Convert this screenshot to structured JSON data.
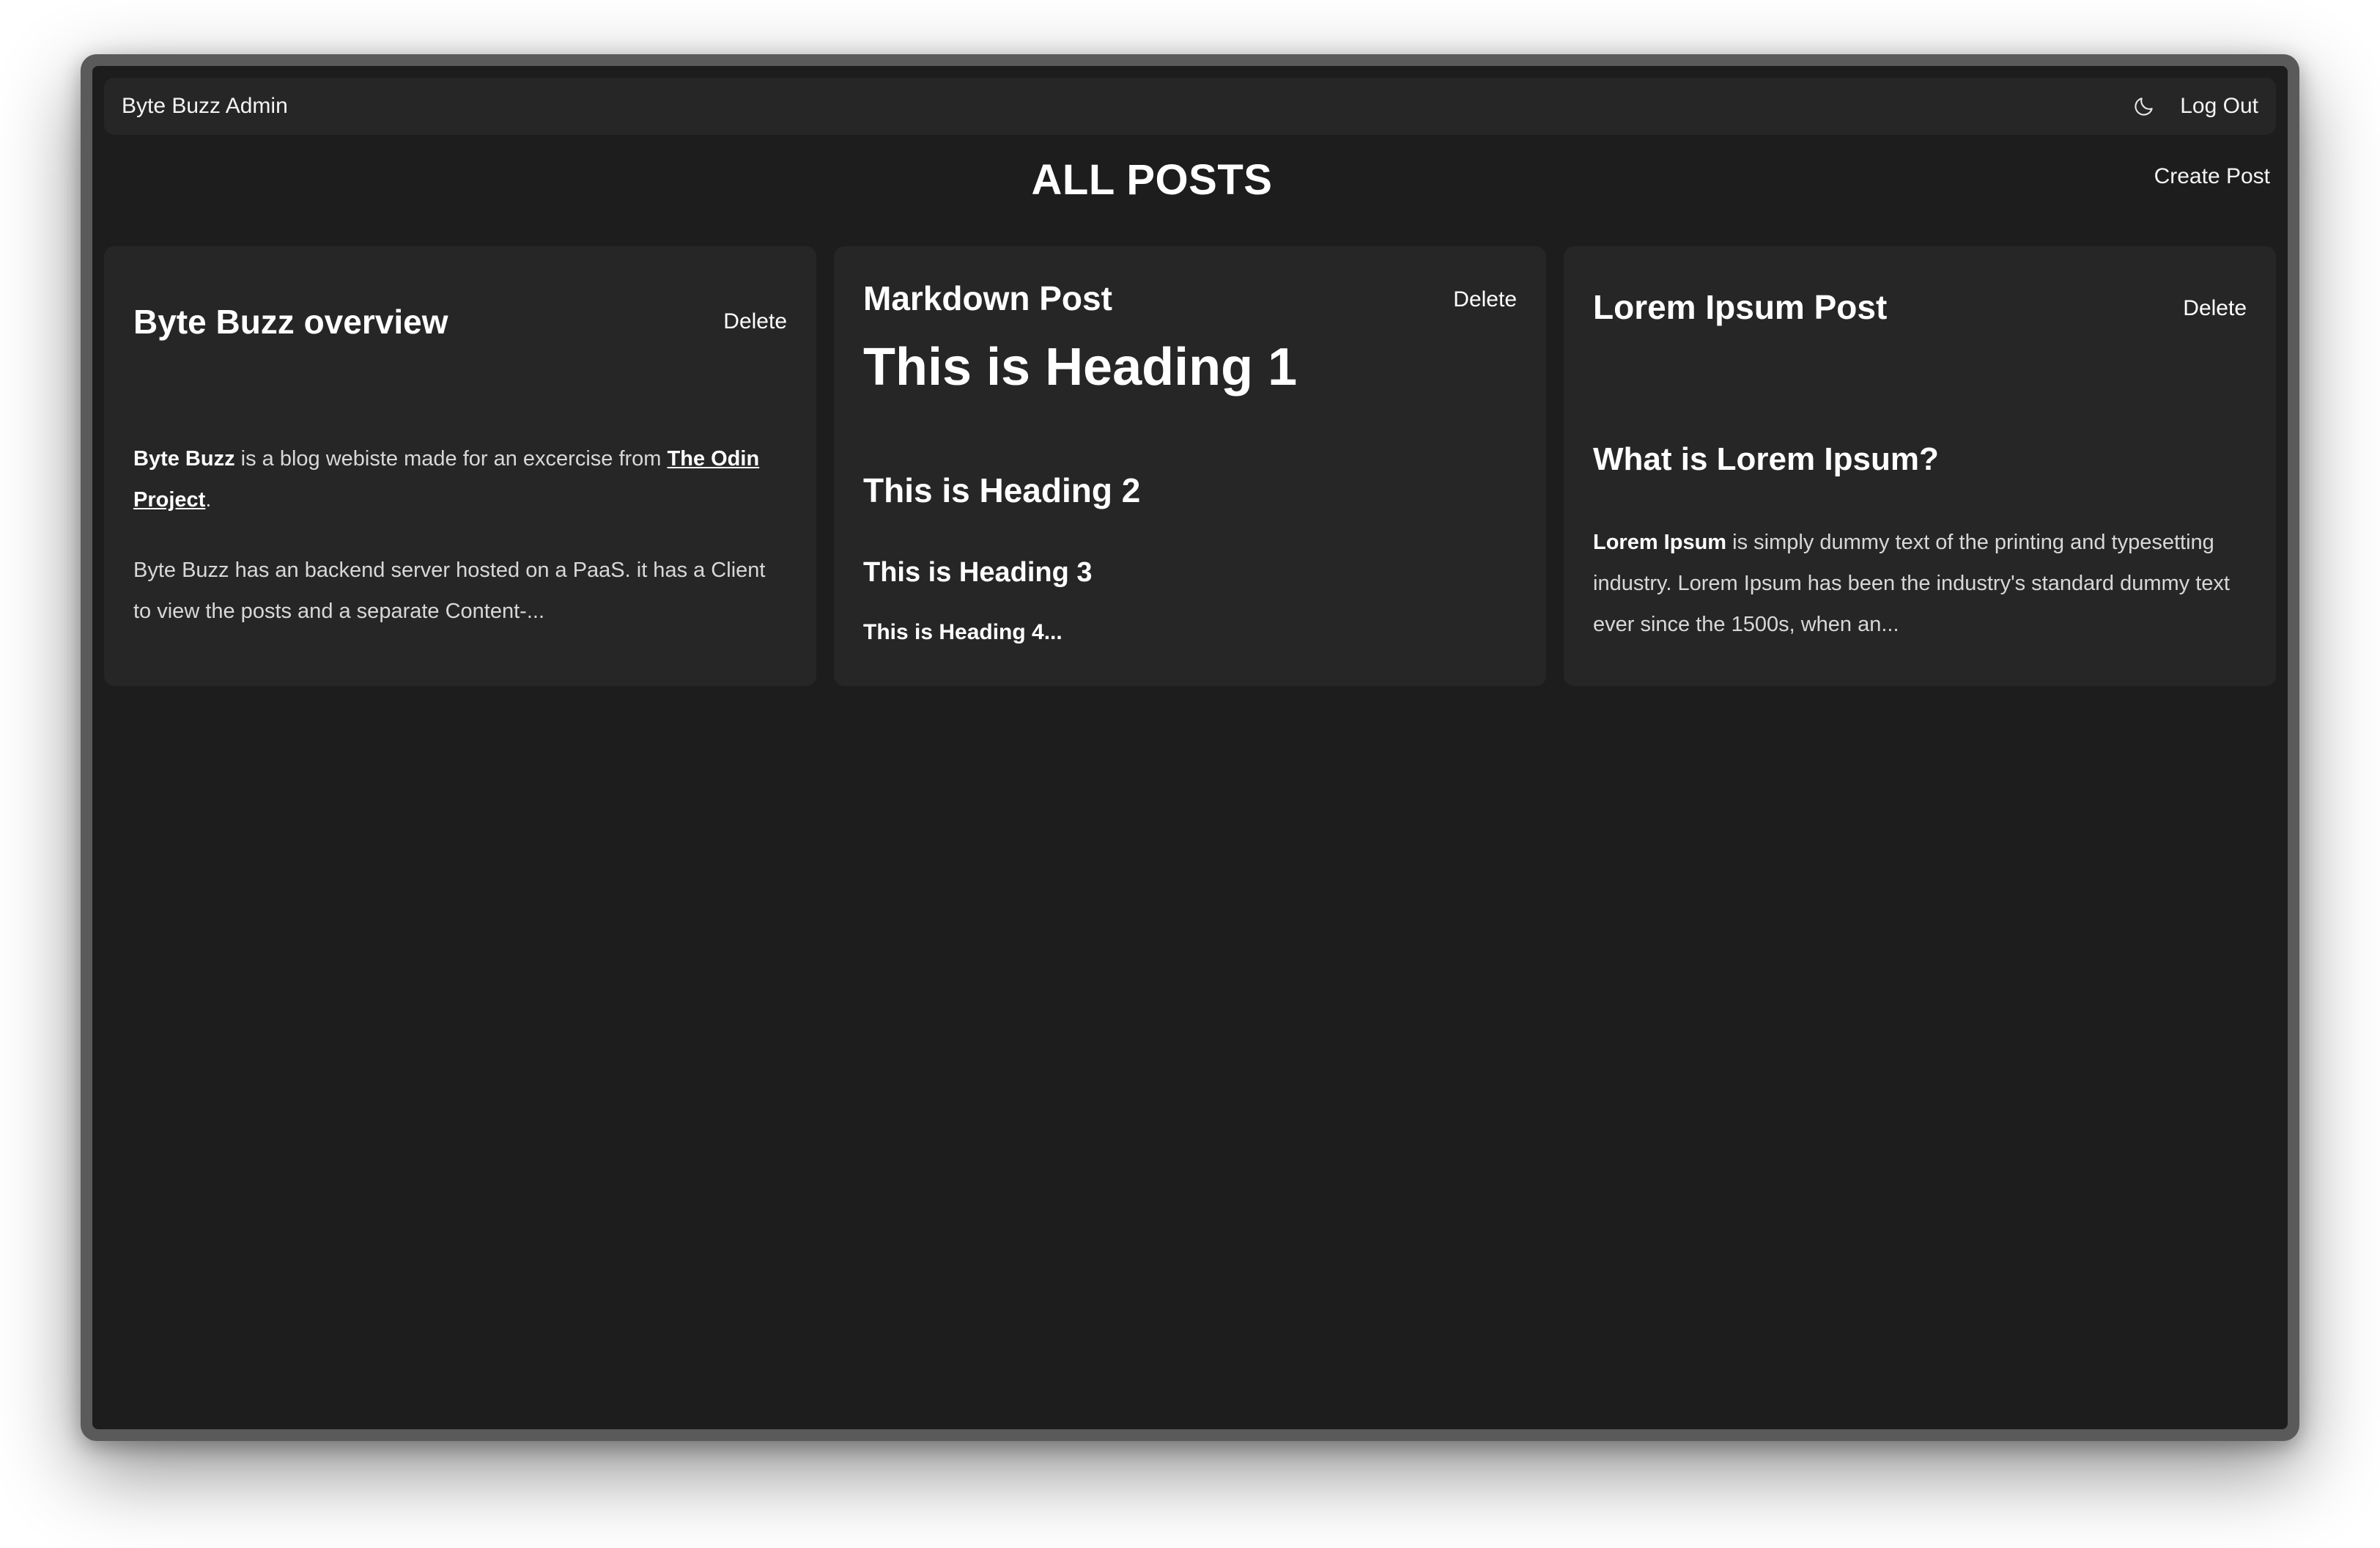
{
  "navbar": {
    "brand": "Byte Buzz Admin",
    "theme_icon": "moon-icon",
    "logout_label": "Log Out"
  },
  "page": {
    "title": "ALL POSTS",
    "create_post_label": "Create Post"
  },
  "posts": [
    {
      "title": "Byte Buzz overview",
      "delete_label": "Delete",
      "p1_bold": "Byte Buzz",
      "p1_text": " is a blog webiste made for an excercise from ",
      "p1_link": "The Odin Project",
      "p1_end": ".",
      "p2": "Byte Buzz has an backend server hosted on a PaaS. it has a Client to view the posts and a separate Content-..."
    },
    {
      "title": "Markdown Post",
      "delete_label": "Delete",
      "h1": "This is Heading 1",
      "h2": "This is Heading 2",
      "h3": "This is Heading 3",
      "h4": "This is Heading 4..."
    },
    {
      "title": "Lorem Ipsum Post",
      "delete_label": "Delete",
      "subheading": "What is Lorem Ipsum?",
      "p_bold": "Lorem Ipsum",
      "p_text": " is simply dummy text of the printing and typesetting industry. Lorem Ipsum has been the industry's standard dummy text ever since the 1500s, when an..."
    }
  ],
  "colors": {
    "background": "#1d1d1d",
    "surface": "#262626",
    "text": "#f1f1f1"
  }
}
